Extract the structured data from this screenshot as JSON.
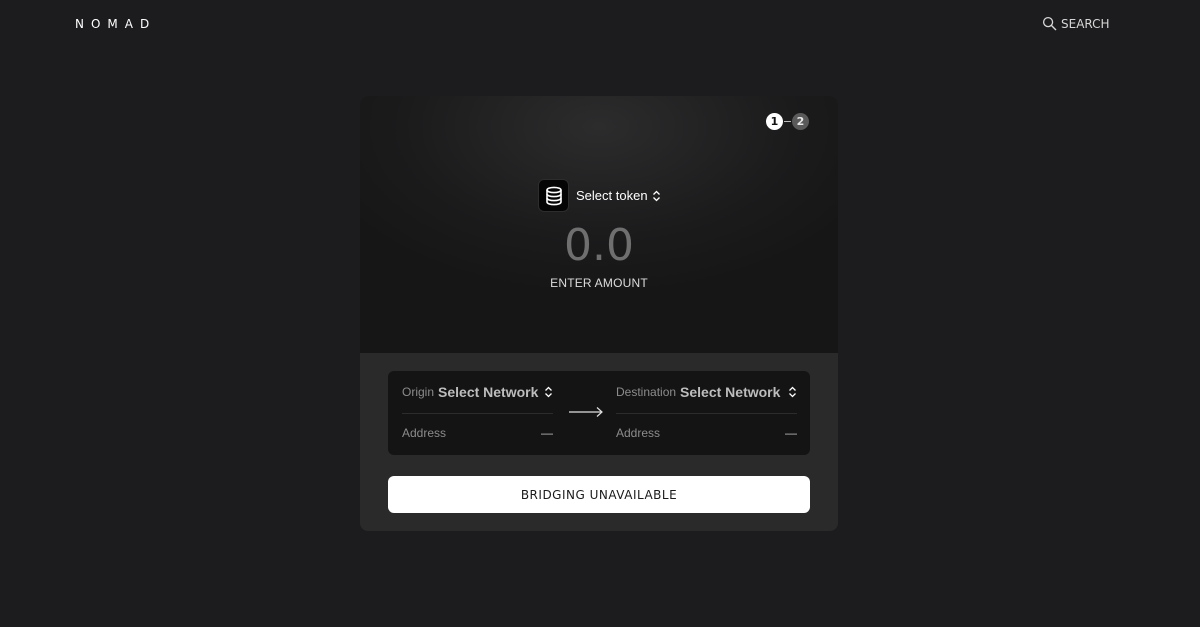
{
  "header": {
    "logo": "NOMAD",
    "search_label": "SEARCH"
  },
  "steps": {
    "current": "1",
    "next": "2"
  },
  "token": {
    "label": "Select token",
    "icon": "database-icon"
  },
  "amount": {
    "value": "0.0",
    "label": "ENTER AMOUNT"
  },
  "origin": {
    "caption": "Origin",
    "network": "Select Network",
    "address_label": "Address",
    "address_value": "—"
  },
  "destination": {
    "caption": "Destination",
    "network": "Select Network",
    "address_label": "Address",
    "address_value": "—"
  },
  "action": {
    "button_label": "BRIDGING UNAVAILABLE"
  },
  "colors": {
    "background": "#1c1c1e",
    "card_bottom": "#2a2a2b",
    "button": "#ffffff"
  }
}
